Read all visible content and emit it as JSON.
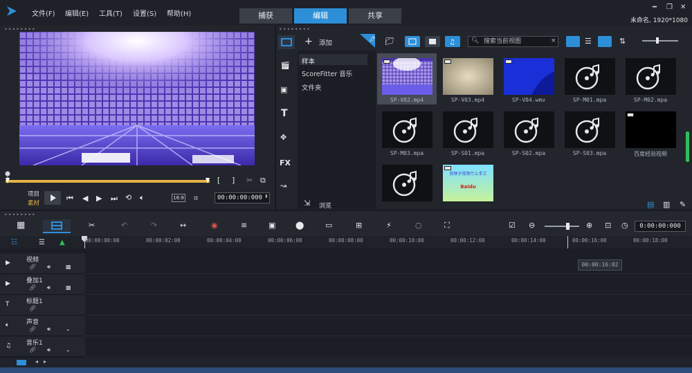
{
  "menu": [
    "文件(F)",
    "编辑(E)",
    "工具(T)",
    "设置(S)",
    "帮助(H)"
  ],
  "tabs": [
    "捕获",
    "编辑",
    "共享"
  ],
  "active_tab": "编辑",
  "project_info": "未命名, 1920*1080",
  "player": {
    "grip": "••••••••",
    "item_label": "项目",
    "clip_label": "素材",
    "aspect": "16:9",
    "timecode": "00:00:00:000",
    "mark_in": "[",
    "mark_out": "]"
  },
  "library": {
    "grip": "••••••••",
    "add_label": "添加",
    "folders": [
      "样本",
      "ScoreFitter 音乐",
      "文件夹"
    ],
    "search_placeholder": "搜索当前视图",
    "browse_label": "浏览",
    "items": [
      {
        "name": "SP-V02.mp4",
        "kind": "video-disco",
        "selected": true
      },
      {
        "name": "SP-V03.mp4",
        "kind": "video-beige"
      },
      {
        "name": "SP-V04.wmv",
        "kind": "video-blue"
      },
      {
        "name": "SP-M01.mpa",
        "kind": "audio"
      },
      {
        "name": "SP-M02.mpa",
        "kind": "audio"
      },
      {
        "name": "SP-M03.mpa",
        "kind": "audio"
      },
      {
        "name": "SP-S01.mpa",
        "kind": "audio"
      },
      {
        "name": "SP-S02.mpa",
        "kind": "audio"
      },
      {
        "name": "SP-S03.mpa",
        "kind": "audio"
      },
      {
        "name": "百度经验视频",
        "kind": "video-black"
      },
      {
        "name": "",
        "kind": "audio"
      },
      {
        "name": "",
        "kind": "image-baidu",
        "caption": "剪映子视频什么手工",
        "logo": "Baidu"
      }
    ]
  },
  "timeline": {
    "grip": "••••••••",
    "timecode": "0:00:00:000",
    "ruler": [
      "00:00:00:00",
      "00:00:02:00",
      "00:00:04:00",
      "00:00:06:00",
      "00:00:08:00",
      "00:00:10:00",
      "00:00:12:00",
      "00:00:14:00",
      "00:00:16:00",
      "00:00:18:00"
    ],
    "tooltip": "00:00:16:02",
    "tracks": [
      "视频",
      "叠加1",
      "标题1",
      "声音",
      "音乐1"
    ]
  },
  "colors": {
    "accent": "#2d8fd8",
    "scrub": "#e6b347"
  }
}
